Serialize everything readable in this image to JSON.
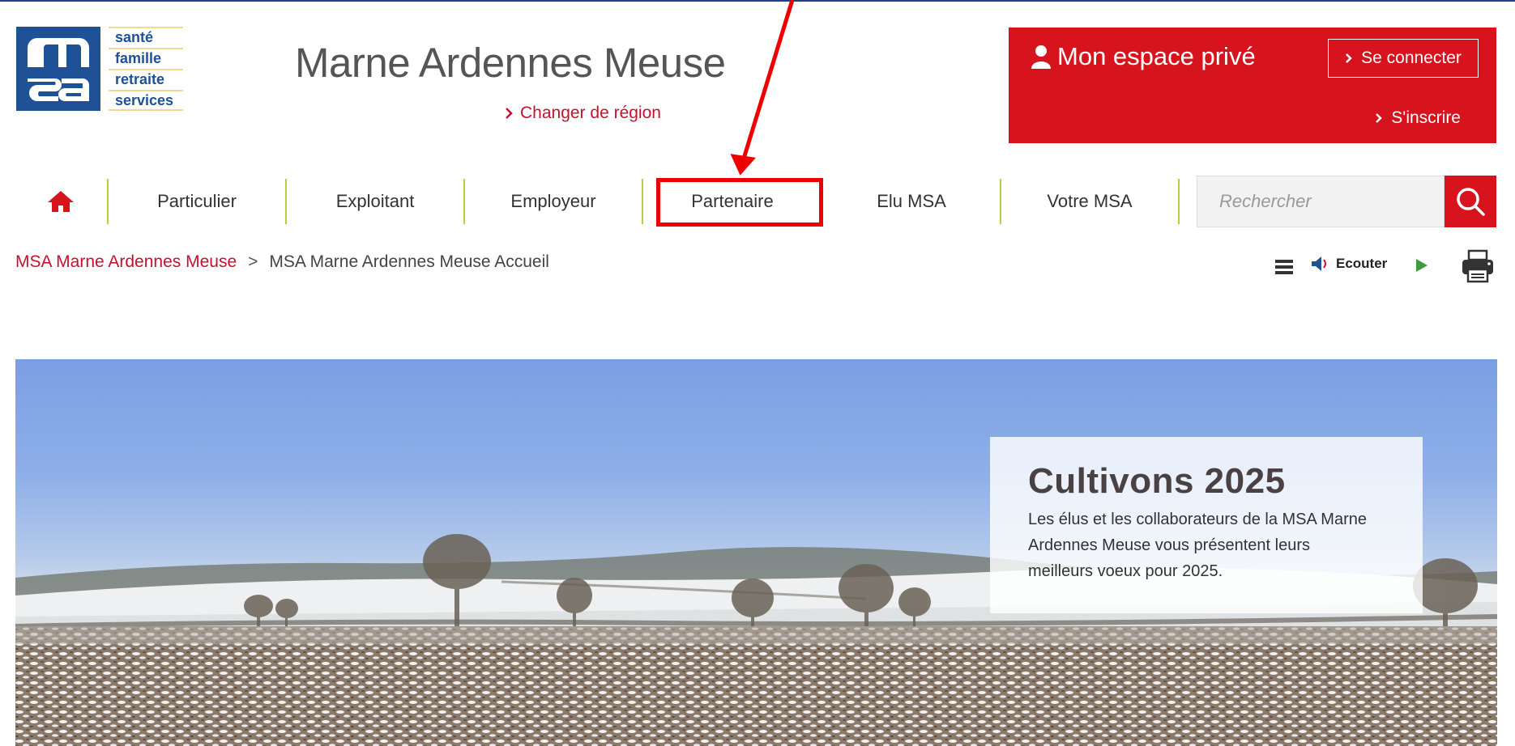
{
  "logo": {
    "words": [
      "santé",
      "famille",
      "retraite",
      "services"
    ]
  },
  "header": {
    "site_title": "Marne Ardennes Meuse",
    "change_region": "Changer de région"
  },
  "private_space": {
    "title": "Mon espace privé",
    "connect": "Se connecter",
    "register": "S'inscrire",
    "bg_color": "#d7131d"
  },
  "nav": {
    "home_icon": "home-icon",
    "items": [
      "Particulier",
      "Exploitant",
      "Employeur",
      "Partenaire",
      "Elu MSA",
      "Votre MSA"
    ],
    "highlighted": "Partenaire"
  },
  "search": {
    "placeholder": "Rechercher",
    "icon": "search-icon"
  },
  "breadcrumb": {
    "link": "MSA Marne Ardennes Meuse",
    "separator": ">",
    "current": "MSA Marne Ardennes Meuse Accueil"
  },
  "tools": {
    "listen": "Ecouter",
    "icons": [
      "menu-icon",
      "speaker-icon",
      "play-icon",
      "print-icon"
    ]
  },
  "hero": {
    "title": "Cultivons 2025",
    "text": "Les élus et les collaborateurs de la MSA Marne Ardennes Meuse vous présentent leurs meilleurs voeux pour 2025."
  },
  "colors": {
    "accent_red": "#c8102e",
    "separator_green": "#b7cf3e",
    "logo_blue": "#1e5196",
    "annotation": "#ee0000"
  }
}
